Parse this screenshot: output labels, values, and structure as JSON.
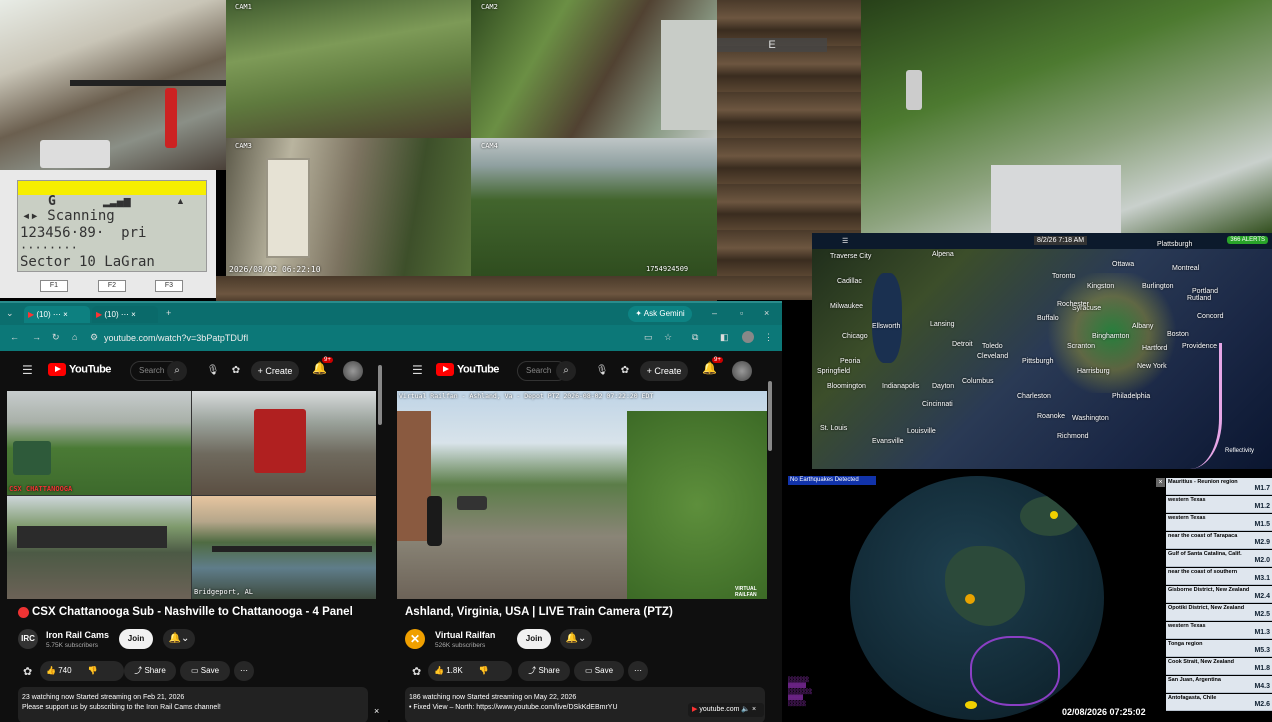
{
  "cams": {
    "cam1": "CAM1",
    "cam2": "CAM2",
    "cam3": "CAM3",
    "cam4": "CAM4",
    "timestamp": "2026/08/02  06:22:10",
    "counter": "1754924509",
    "hud_letter": "E"
  },
  "scanner": {
    "row1": "G",
    "row2": "Scanning",
    "row3": "123456·89·  pri",
    "row4": "········",
    "row5": "Sector 10 LaGran",
    "f1": "F1",
    "f2": "F2",
    "f3": "F3"
  },
  "radar": {
    "time": "8/2/26 7:18 AM",
    "alerts": "366 ALERTS",
    "layer": "Reflectivity",
    "cities": [
      "Traverse City",
      "Alpena",
      "Cadillac",
      "Milwaukee",
      "Lansing",
      "Detroit",
      "Chicago",
      "Toledo",
      "Cleveland",
      "Indianapolis",
      "Columbus",
      "Pittsburgh",
      "Cincinnati",
      "Louisville",
      "Springfield",
      "Peoria",
      "St. Louis",
      "Charleston",
      "Roanoke",
      "Harrisburg",
      "Philadelphia",
      "Washington",
      "Richmond",
      "New York",
      "Boston",
      "Albany",
      "Syracuse",
      "Buffalo",
      "Toronto",
      "Montreal",
      "Ottawa",
      "Burlington",
      "Portland",
      "Providence",
      "Hartford",
      "Scranton",
      "Binghamton",
      "Rochester",
      "Kingston",
      "Plattsburgh",
      "Rutland",
      "Concord",
      "Evansville",
      "Bloomington",
      "Ellsworth",
      "Dayton"
    ]
  },
  "quake": {
    "header": "No Earthquakes Detected",
    "datetime": "02/08/2026 07:25:02",
    "events": [
      {
        "place": "Mauritius - Reunion region",
        "mag": "M1.7"
      },
      {
        "place": "western Texas",
        "mag": "M1.2"
      },
      {
        "place": "western Texas",
        "mag": "M1.5"
      },
      {
        "place": "near the coast of Tarapaca",
        "mag": "M2.9"
      },
      {
        "place": "Gulf of Santa Catalina, Calif.",
        "mag": "M2.0"
      },
      {
        "place": "near the coast of southern",
        "mag": "M3.1"
      },
      {
        "place": "Gisborne District, New Zealand",
        "mag": "M2.4"
      },
      {
        "place": "Opotiki District, New Zealand",
        "mag": "M2.5"
      },
      {
        "place": "western Texas",
        "mag": "M1.3"
      },
      {
        "place": "Tonga region",
        "mag": "M5.3"
      },
      {
        "place": "Cook Strait, New Zealand",
        "mag": "M1.8"
      },
      {
        "place": "San Juan, Argentina",
        "mag": "M4.3"
      },
      {
        "place": "Antofagasta, Chile",
        "mag": "M2.6"
      }
    ]
  },
  "browser": {
    "tab1": "(10)",
    "tab2": "(10)",
    "ask": "Ask Gemini",
    "url": "youtube.com/watch?v=3bPatpTDUfI",
    "yt_logo": "YouTube",
    "search_placeholder": "Search",
    "create": "Create",
    "notif": "9+",
    "left": {
      "title": "CSX Chattanooga Sub - Nashville to Chattanooga - 4 Panel",
      "channel": "Iron Rail Cams",
      "subs": "5.75K subscribers",
      "join": "Join",
      "likes": "740",
      "share": "Share",
      "save": "Save",
      "desc1": "23 watching now  Started streaming on Feb 21, 2026",
      "desc2": "Please support us by subscribing to the Iron Rail Cams channel!",
      "tl": "CSX CHATTANOOGA",
      "bl": "Bridgeport, AL"
    },
    "right": {
      "overlay": "Virtual Railfan - Ashland, Va - Depot PTZ  2026-08-02 07:22:20 EDT",
      "title": "Ashland, Virginia, USA | LIVE Train Camera (PTZ)",
      "channel": "Virtual Railfan",
      "subs": "526K subscribers",
      "join": "Join",
      "likes": "1.8K",
      "share": "Share",
      "save": "Save",
      "desc1": "186 watching now  Started streaming on May 22, 2026",
      "desc2": "• Fixed View – North: https://www.youtube.com/live/DSkKdEBmrYU",
      "watermark": "VIRTUAL RAILFAN"
    },
    "mini": "youtube.com"
  }
}
